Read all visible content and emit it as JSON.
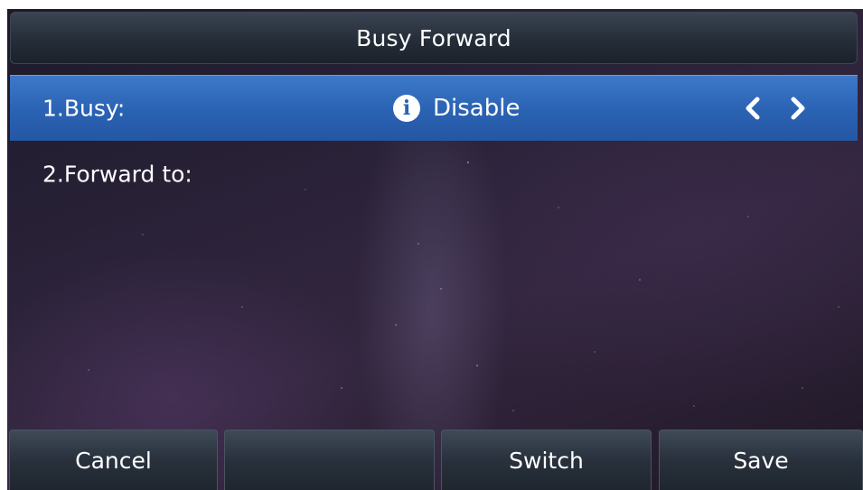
{
  "header": {
    "title": "Busy Forward"
  },
  "rows": [
    {
      "label": "1.Busy:",
      "value": "Disable",
      "info_icon": "info-icon",
      "left_arrow_icon": "chevron-left-icon",
      "right_arrow_icon": "chevron-right-icon"
    },
    {
      "label": "2.Forward to:"
    }
  ],
  "softkeys": [
    {
      "label": "Cancel"
    },
    {
      "label": ""
    },
    {
      "label": "Switch"
    },
    {
      "label": "Save"
    }
  ],
  "colors": {
    "selected_row": "#2a62b3",
    "title_bar": "#252d38",
    "softkey": "#28313c",
    "text": "#ffffff"
  }
}
